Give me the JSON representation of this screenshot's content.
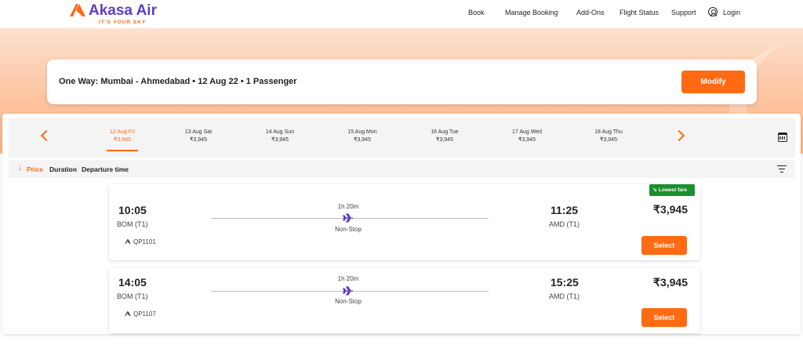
{
  "brand": {
    "name": "Akasa Air",
    "tagline": "IT'S YOUR SKY"
  },
  "nav": {
    "links": [
      "Book",
      "Manage Booking",
      "Add-Ons",
      "Flight Status",
      "Support"
    ],
    "login": "Login"
  },
  "search": {
    "summary": "One Way: Mumbai - Ahmedabad • 12 Aug 22 • 1 Passenger",
    "modify_label": "Modify"
  },
  "dates": [
    {
      "label": "12 Aug Fri",
      "price": "₹3,945",
      "active": true
    },
    {
      "label": "13 Aug Sat",
      "price": "₹3,945",
      "active": false
    },
    {
      "label": "14 Aug Sun",
      "price": "₹3,945",
      "active": false
    },
    {
      "label": "15 Aug Mon",
      "price": "₹3,945",
      "active": false
    },
    {
      "label": "16 Aug Tue",
      "price": "₹3,945",
      "active": false
    },
    {
      "label": "17 Aug Wed",
      "price": "₹3,945",
      "active": false
    },
    {
      "label": "18 Aug Thu",
      "price": "₹3,945",
      "active": false
    }
  ],
  "sort": {
    "options": [
      "Price",
      "Duration",
      "Departure time"
    ],
    "active": "Price"
  },
  "flights": [
    {
      "dep_time": "10:05",
      "dep_code": "BOM (T1)",
      "arr_time": "11:25",
      "arr_code": "AMD (T1)",
      "duration": "1h 20m",
      "stops": "Non-Stop",
      "flight_no": "QP1101",
      "fare": "₹3,945",
      "badge": "Lowest fare",
      "select_label": "Select"
    },
    {
      "dep_time": "14:05",
      "dep_code": "BOM (T1)",
      "arr_time": "15:25",
      "arr_code": "AMD (T1)",
      "duration": "1h 20m",
      "stops": "Non-Stop",
      "flight_no": "QP1107",
      "fare": "₹3,945",
      "select_label": "Select"
    }
  ],
  "colors": {
    "brand_purple": "#5e3ec2",
    "accent_orange": "#ff6a13",
    "badge_green": "#1b8f2e",
    "plane_purple": "#5e3ec2"
  }
}
